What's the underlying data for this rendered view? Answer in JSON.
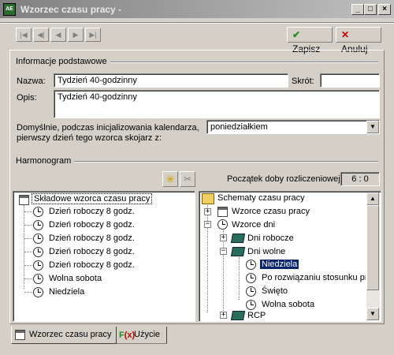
{
  "window": {
    "title": "Wzorzec czasu pracy -",
    "app_icon": "calendar-app-icon",
    "controls": {
      "minimize": "_",
      "maximize": "□",
      "close": "×"
    }
  },
  "toolbar": {
    "nav": [
      "|◀",
      "◀|",
      "◀",
      "▶",
      "▶|"
    ],
    "save_label": "Zapisz",
    "cancel_label": "Anuluj",
    "colors": {
      "save_check": "#2a8a2a",
      "cancel_x": "#cc0000"
    }
  },
  "basic": {
    "section": "Informacje podstawowe",
    "name_label": "Nazwa:",
    "name_value": "Tydzień 40-godzinny",
    "short_label": "Skrót:",
    "short_value": "",
    "desc_label": "Opis:",
    "desc_value": "Tydzień 40-godzinny",
    "first_day_label_1": "Domyślnie, podczas inicjalizowania kalendarza,",
    "first_day_label_2": "pierwszy dzień tego wzorca skojarz z:",
    "first_day_value": "poniedziałkiem"
  },
  "schedule": {
    "section": "Harmonogram",
    "start_label": "Początek doby rozliczeniowej",
    "start_value": "6 : 0",
    "left_tree": {
      "root": "Składowe wzorca czasu pracy",
      "items": [
        "Dzień roboczy 8 godz.",
        "Dzień roboczy 8 godz.",
        "Dzień roboczy 8 godz.",
        "Dzień roboczy 8 godz.",
        "Dzień roboczy 8 godz.",
        "Wolna sobota",
        "Niedziela"
      ]
    },
    "right_tree": {
      "root": "Schematy czasu pracy",
      "wzorce": "Wzorce czasu pracy",
      "wzorce_dni": "Wzorce dni",
      "dni_robocze": "Dni robocze",
      "dni_wolne": "Dni wolne",
      "children": [
        "Niedziela",
        "Po rozwiązaniu stosunku pra",
        "Święto",
        "Wolna sobota"
      ],
      "rcp": "RCP"
    }
  },
  "tabs": [
    {
      "label": "Wzorzec czasu pracy",
      "icon": "calendar-icon"
    },
    {
      "label": "Użycie",
      "icon": "function-icon"
    }
  ]
}
